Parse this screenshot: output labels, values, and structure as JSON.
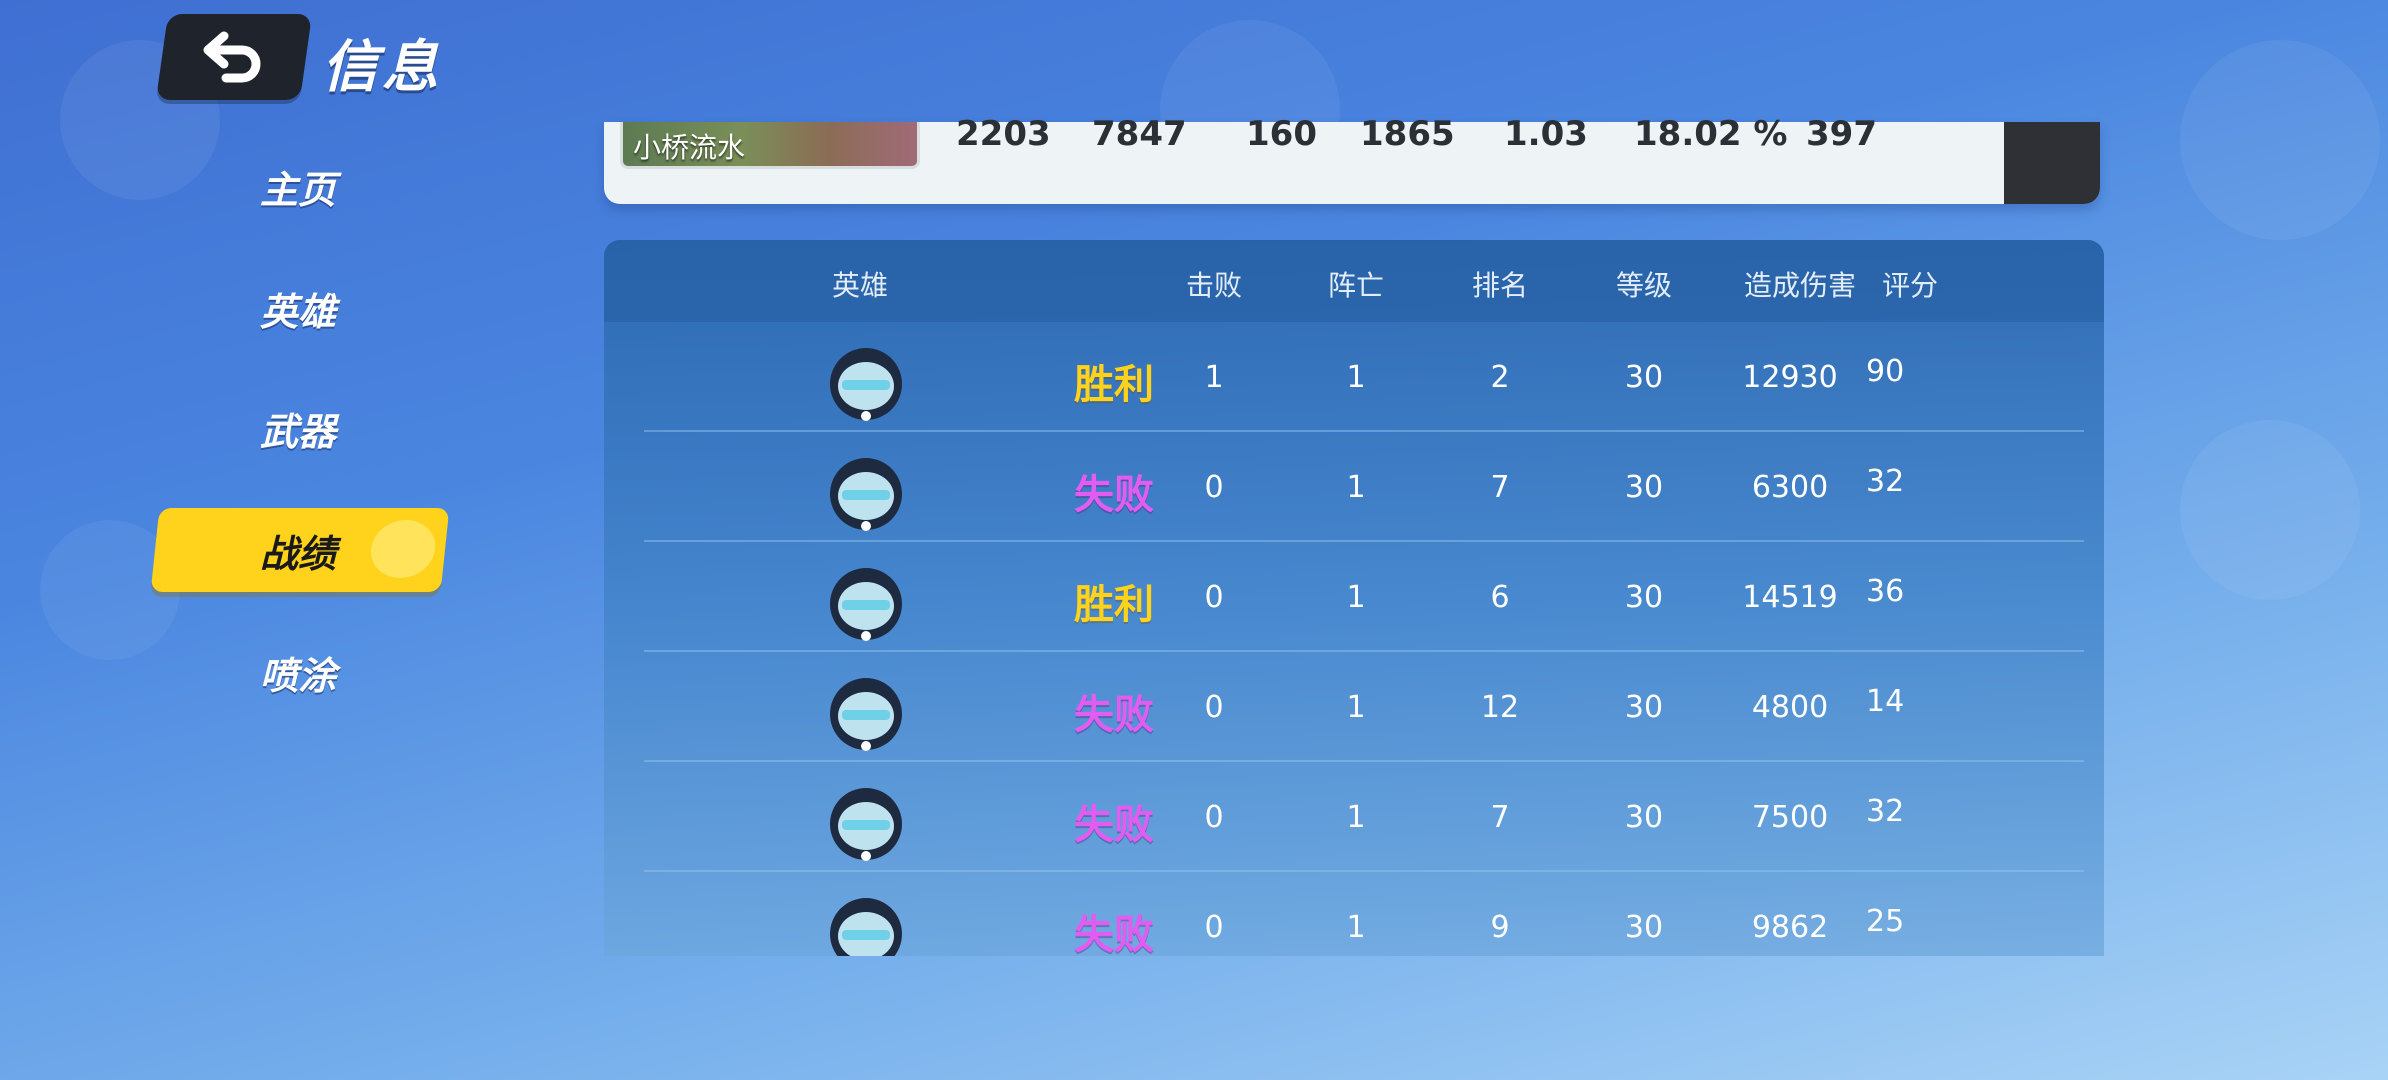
{
  "header": {
    "title": "信息"
  },
  "nav": {
    "items": [
      {
        "label": "主页",
        "active": false
      },
      {
        "label": "英雄",
        "active": false
      },
      {
        "label": "武器",
        "active": false
      },
      {
        "label": "战绩",
        "active": true
      },
      {
        "label": "喷涂",
        "active": false
      }
    ]
  },
  "summary": {
    "map_name": "小桥流水",
    "stats": [
      "2203",
      "7847",
      "160",
      "1865",
      "1.03",
      "18.02 %",
      "397"
    ]
  },
  "table": {
    "columns": {
      "hero": "英雄",
      "kills": "击败",
      "deaths": "阵亡",
      "rank": "排名",
      "level": "等级",
      "damage": "造成伤害",
      "score": "评分"
    },
    "rows": [
      {
        "result": "胜利",
        "outcome": "win",
        "kills": "1",
        "deaths": "1",
        "rank": "2",
        "level": "30",
        "damage": "12930",
        "score": "90"
      },
      {
        "result": "失败",
        "outcome": "lose",
        "kills": "0",
        "deaths": "1",
        "rank": "7",
        "level": "30",
        "damage": "6300",
        "score": "32"
      },
      {
        "result": "胜利",
        "outcome": "win",
        "kills": "0",
        "deaths": "1",
        "rank": "6",
        "level": "30",
        "damage": "14519",
        "score": "36"
      },
      {
        "result": "失败",
        "outcome": "lose",
        "kills": "0",
        "deaths": "1",
        "rank": "12",
        "level": "30",
        "damage": "4800",
        "score": "14"
      },
      {
        "result": "失败",
        "outcome": "lose",
        "kills": "0",
        "deaths": "1",
        "rank": "7",
        "level": "30",
        "damage": "7500",
        "score": "32"
      },
      {
        "result": "失败",
        "outcome": "lose",
        "kills": "0",
        "deaths": "1",
        "rank": "9",
        "level": "30",
        "damage": "9862",
        "score": "25"
      }
    ]
  },
  "colors": {
    "win": "#ffd21c",
    "lose": "#e35cf2",
    "nav_active": "#ffd21c"
  }
}
